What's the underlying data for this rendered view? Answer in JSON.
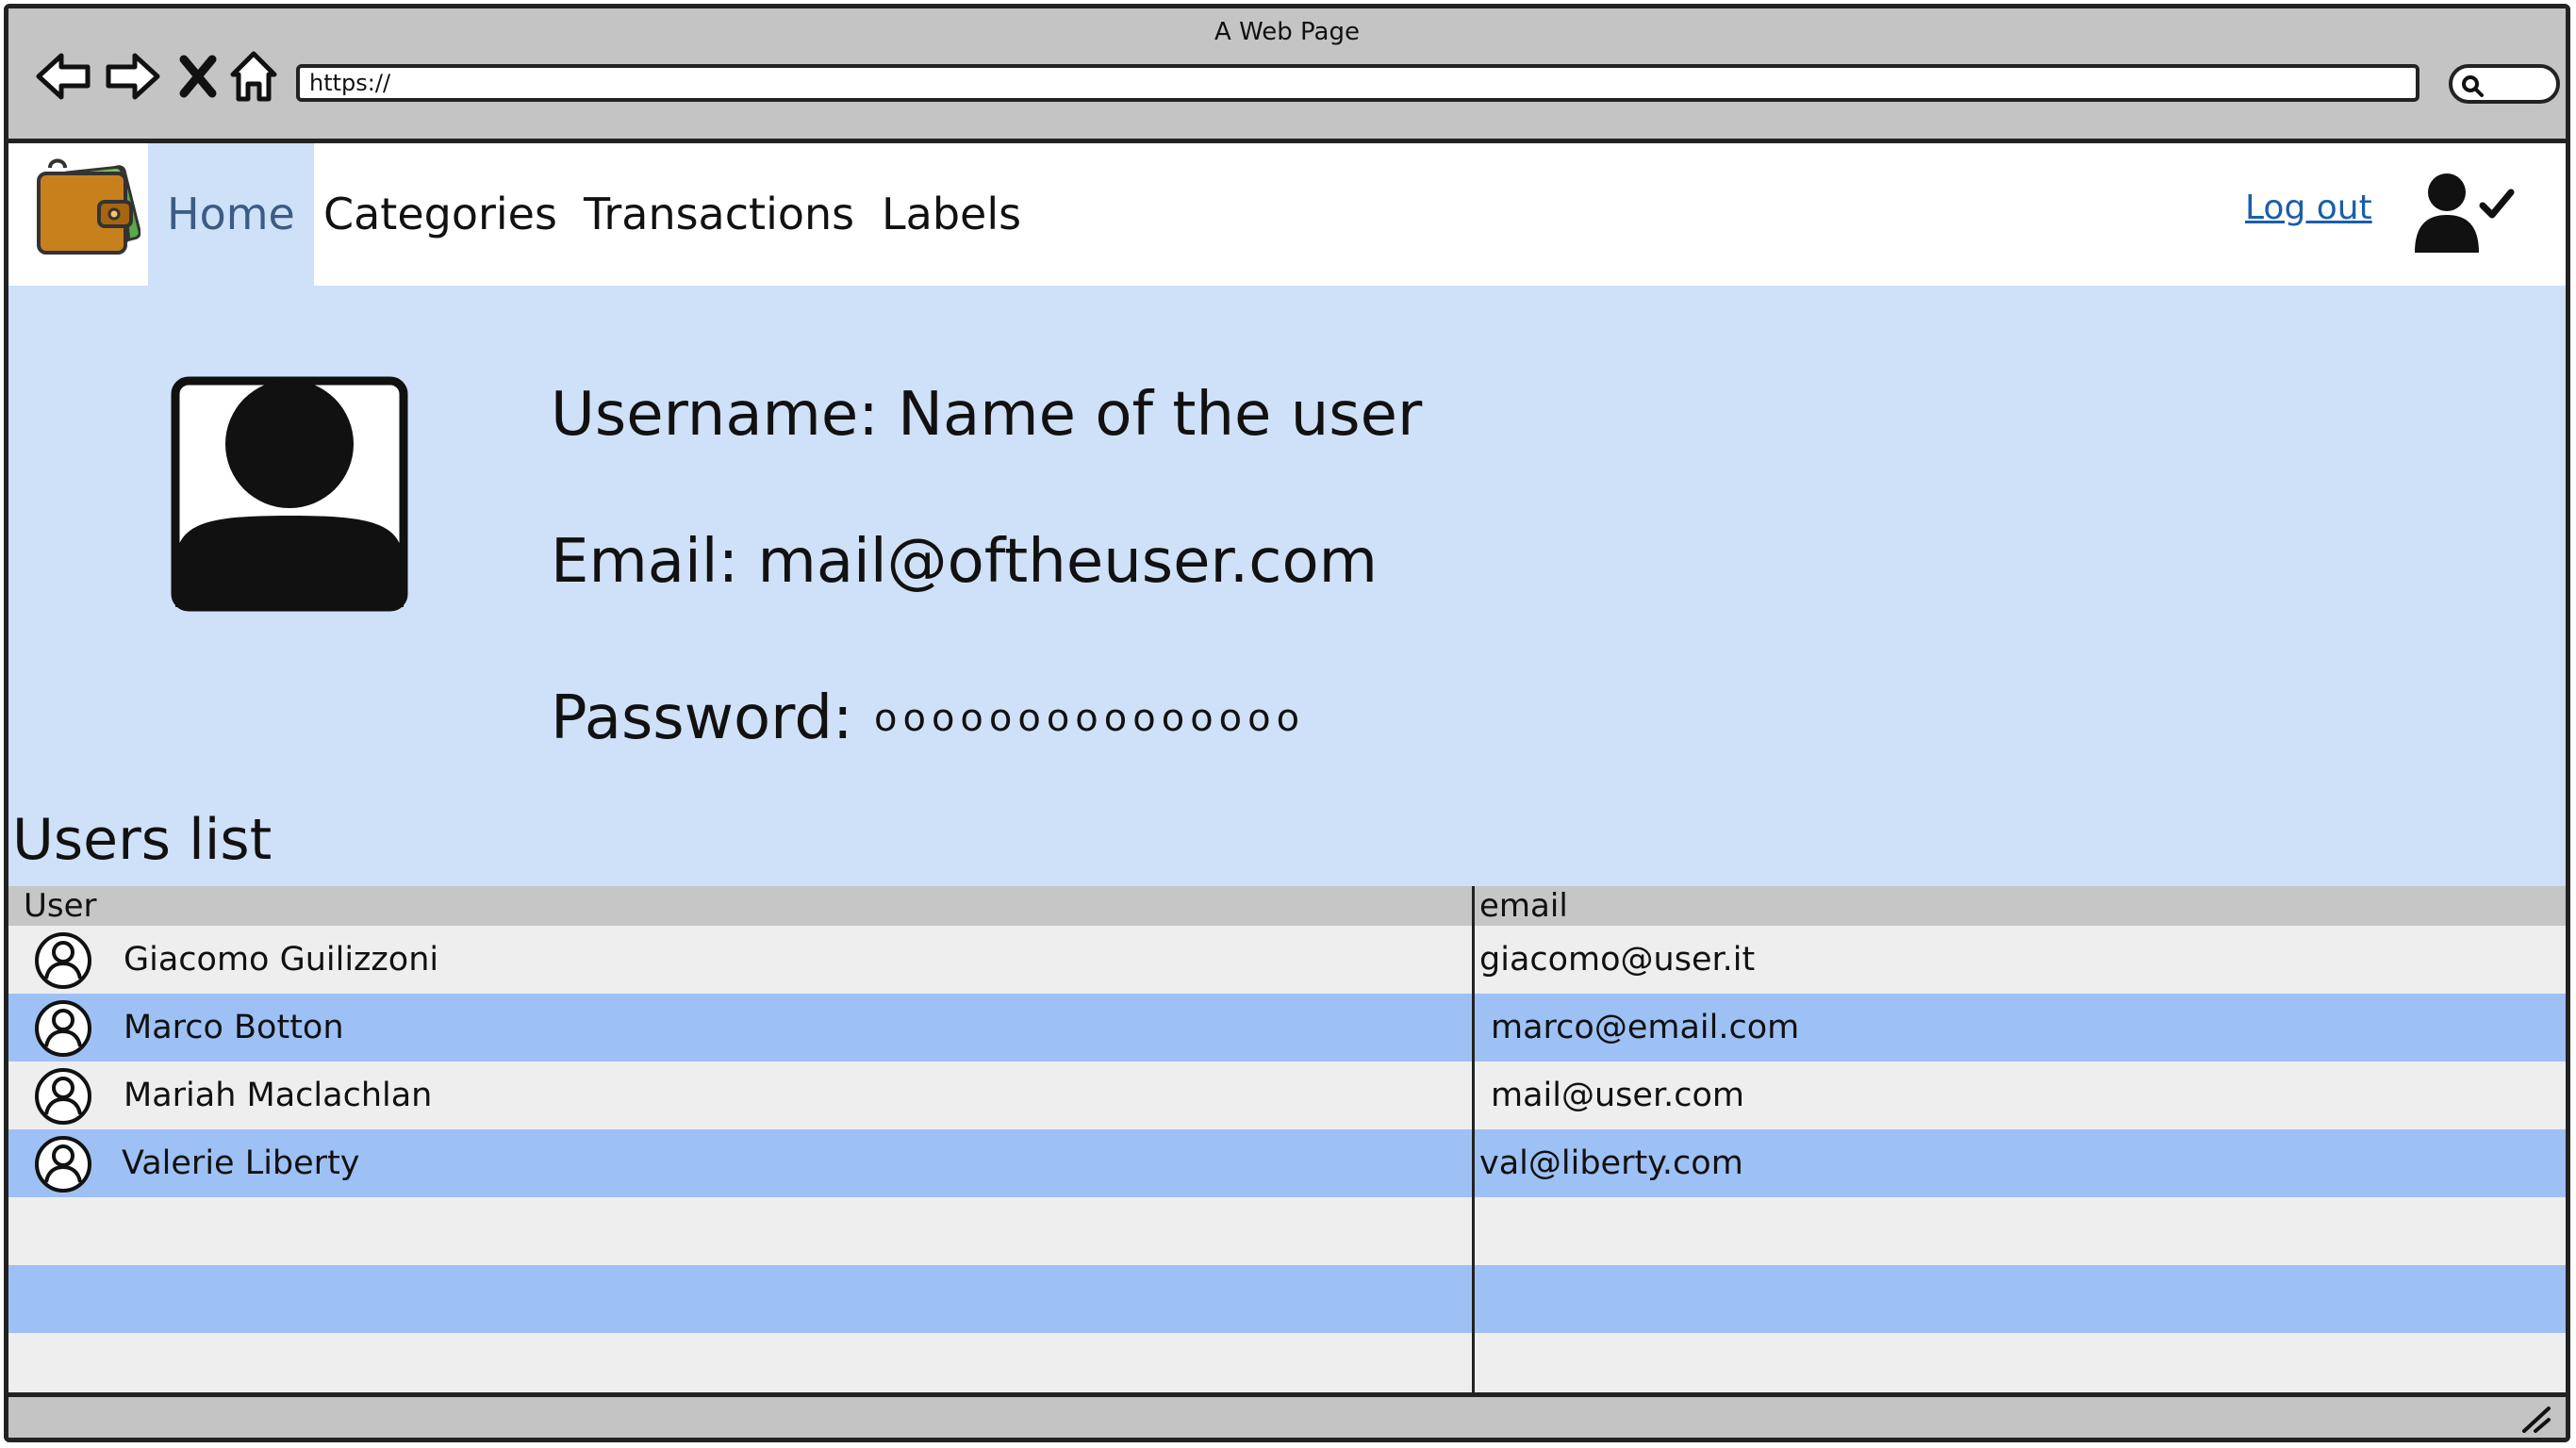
{
  "browser": {
    "window_title": "A Web Page",
    "url": "https://"
  },
  "header": {
    "nav": [
      {
        "label": "Home",
        "active": true
      },
      {
        "label": "Categories",
        "active": false
      },
      {
        "label": "Transactions",
        "active": false
      },
      {
        "label": "Labels",
        "active": false
      }
    ],
    "logout_label": "Log out",
    "logo_icon": "wallet-icon",
    "user_icon": "user-check-icon"
  },
  "profile": {
    "username_line": "Username: Name of the user",
    "email_line": "Email: mail@oftheuser.com",
    "password_label": "Password:",
    "password_mask": "ooooooooooooooo"
  },
  "users": {
    "title": "Users list",
    "columns": [
      "User",
      "email"
    ],
    "rows": [
      {
        "name": "Giacomo Guilizzoni",
        "email": "giacomo@user.it"
      },
      {
        "name": "Marco Botton",
        "email": "marco@email.com"
      },
      {
        "name": "Mariah Maclachlan",
        "email": "mail@user.com"
      },
      {
        "name": "Valerie Liberty",
        "email": "val@liberty.com"
      }
    ]
  },
  "colors": {
    "page_blue": "#cfe1f8",
    "row_blue": "#9dc1f5",
    "row_light": "#eeeeee",
    "header_gray": "#c6c6c6",
    "link": "#1b5eaa"
  }
}
